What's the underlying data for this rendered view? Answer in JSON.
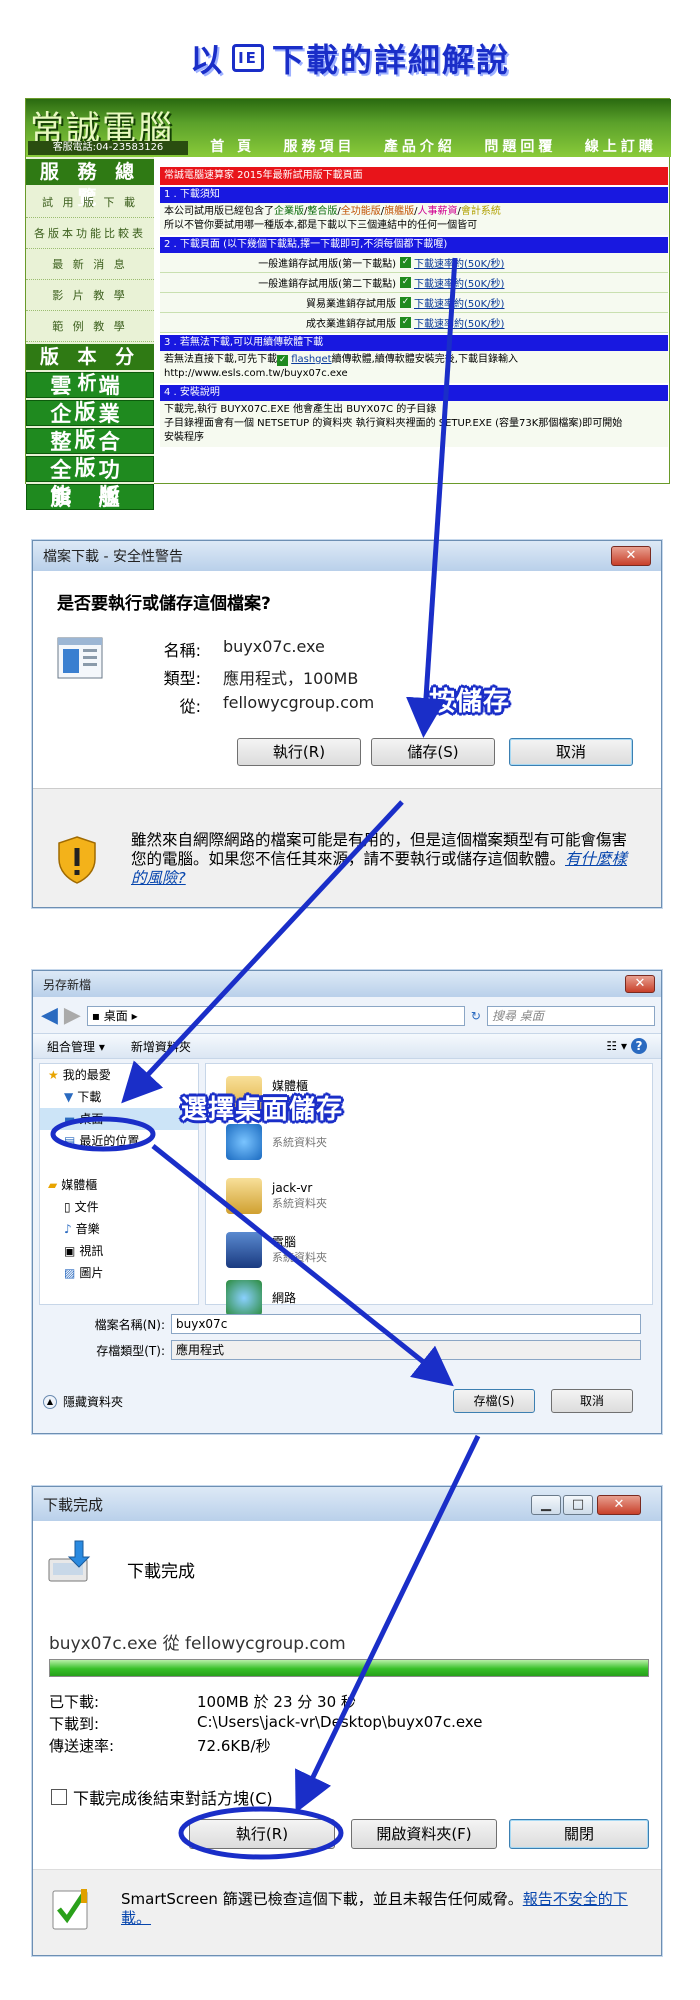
{
  "page_title": {
    "pre": "以",
    "ie": "IE",
    "post": "下載的詳細解說"
  },
  "site": {
    "logo": "常誠電腦",
    "phone": "客服電話:04-23583126",
    "nav": [
      "首 頁",
      "服務項目",
      "產品介紹",
      "問題回覆",
      "線上訂購"
    ],
    "side_header1": "服 務 總 覽",
    "side_items": [
      "試 用 版 下 載",
      "各版本功能比較表",
      "最 新 消 息",
      "影 片 教 學",
      "範 例 教 學"
    ],
    "side_header2": "版 本 分 析",
    "versions": [
      "雲 端 版",
      "企 業 版",
      "整 合 版",
      "全 功 能 版",
      "旗 艦 版"
    ],
    "banner": "常誠電腦速算家 2015年最新試用版下載頁面",
    "s1_title": "1 . 下載須知",
    "s1_line1_pre": "本公司試用版已經包含了",
    "s1_products": [
      "企業版",
      "整合版",
      "全功能版",
      "旗艦版",
      "人事薪資",
      "會計系統"
    ],
    "s1_line2": "所以不管你要試用哪一種版本,都是下載以下三個連結中的任何一個皆可",
    "s2_title": "2 . 下載頁面 (以下幾個下載點,擇一下載即可,不須每個都下載喔)",
    "downloads": [
      {
        "name": "一般進銷存試用版(第一下載點)",
        "link": "下載速率約(50K/秒)"
      },
      {
        "name": "一般進銷存試用版(第二下載點)",
        "link": "下載速率約(50K/秒)"
      },
      {
        "name": "貿易業進銷存試用版",
        "link": "下載速率約(50K/秒)"
      },
      {
        "name": "成衣業進銷存試用版",
        "link": "下載速率約(50K/秒)"
      }
    ],
    "s3_title": "3 . 若無法下載,可以用續傳軟體下載",
    "s3_line1_pre": "若無法直接下載,可先下載",
    "s3_flashget": "flashget",
    "s3_line1_post": "續傳軟體,續傳軟體安裝完後,下載目錄輸入",
    "s3_line2": "http://www.esls.com.tw/buyx07c.exe",
    "s4_title": "4 . 安裝說明",
    "s4_line1": "下載完,執行 BUYX07C.EXE 他會產生出 BUYX07C 的子目錄",
    "s4_line2": "子目錄裡面會有一個 NETSETUP 的資料夾 執行資料夾裡面的 SETUP.EXE (容量73K那個檔案)即可開始",
    "s4_line3": "安裝程序"
  },
  "security": {
    "title": "檔案下載 - 安全性警告",
    "question": "是否要執行或儲存這個檔案?",
    "name_label": "名稱:",
    "name_value": "buyx07c.exe",
    "type_label": "類型:",
    "type_value": "應用程式，100MB",
    "from_label": "從:",
    "from_value": "fellowycgroup.com",
    "run_btn": "執行(R)",
    "save_btn": "儲存(S)",
    "cancel_btn": "取消",
    "warning": "雖然來自網際網路的檔案可能是有用的，但是這個檔案類型有可能會傷害您的電腦。如果您不信任其來源，請不要執行或儲存這個軟體。",
    "risk_link": "有什麼樣的風險?",
    "annotation": "按儲存"
  },
  "save_as": {
    "title": "另存新檔",
    "address": "▪ 桌面 ▸",
    "search_placeholder": "搜尋 桌面",
    "organize": "組合管理 ▾",
    "new_folder": "新增資料夾",
    "nav_items": [
      "我的最愛",
      "下載",
      "桌面",
      "最近的位置",
      "",
      "媒體櫃",
      "文件",
      "音樂",
      "視訊",
      "圖片"
    ],
    "files": [
      {
        "name": "媒體櫃",
        "sub": "系統資料夾"
      },
      {
        "name": "",
        "sub": "系統資料夾"
      },
      {
        "name": "jack-vr",
        "sub": "系統資料夾"
      },
      {
        "name": "電腦",
        "sub": "系統資料夾"
      },
      {
        "name": "網路",
        "sub": ""
      }
    ],
    "filename_label": "檔案名稱(N):",
    "filename_value": "buyx07c",
    "filetype_label": "存檔類型(T):",
    "filetype_value": "應用程式",
    "hide_folders": "隱藏資料夾",
    "save_btn": "存檔(S)",
    "cancel_btn": "取消",
    "annotation": "選擇桌面儲存"
  },
  "done": {
    "title": "下載完成",
    "heading": "下載完成",
    "file_line": "buyx07c.exe 從 fellowycgroup.com",
    "progress": 1.0,
    "downloaded_label": "已下載:",
    "downloaded_value": "100MB 於 23 分 30 秒",
    "to_label": "下載到:",
    "to_value": "C:\\Users\\jack-vr\\Desktop\\buyx07c.exe",
    "rate_label": "傳送速率:",
    "rate_value": "72.6KB/秒",
    "close_checkbox": "下載完成後結束對話方塊(C)",
    "run_btn": "執行(R)",
    "open_folder_btn": "開啟資料夾(F)",
    "close_btn": "關閉",
    "smartscreen": "SmartScreen 篩選已檢查這個下載，並且未報告任何威脅。",
    "report_link": "報告不安全的下載。"
  },
  "colors": {
    "annotation_blue": "#1a2ec8",
    "site_green": "#2f7a14",
    "progress_green": "#37c028"
  }
}
